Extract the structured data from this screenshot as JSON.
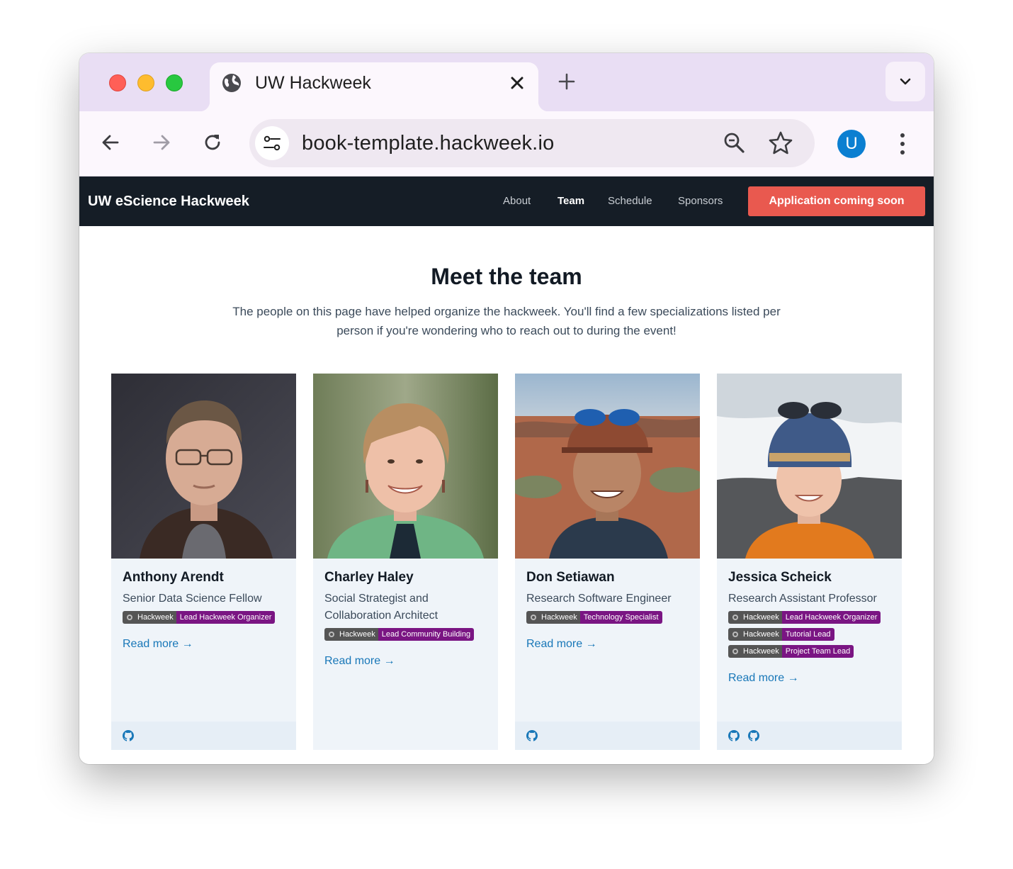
{
  "browser": {
    "tab_title": "UW Hackweek",
    "url": "book-template.hackweek.io",
    "profile_initial": "U"
  },
  "navbar": {
    "brand": "UW eScience Hackweek",
    "links": [
      {
        "label": "About"
      },
      {
        "label": "Team",
        "active": true
      },
      {
        "label": "Schedule"
      },
      {
        "label": "Sponsors"
      }
    ],
    "cta_label": "Application coming soon"
  },
  "page": {
    "title": "Meet the team",
    "intro": "The people on this page have helped organize the hackweek. You'll find a few specializations listed per person if you're wondering who to reach out to during the event!"
  },
  "team": [
    {
      "name": "Anthony Arendt",
      "role": "Senior Data Science Fellow",
      "badges": [
        {
          "left": "Hackweek",
          "right": "Lead Hackweek Organizer"
        }
      ],
      "read_more": "Read more →",
      "footer_icons": [
        "github-icon"
      ]
    },
    {
      "name": "Charley Haley",
      "role": "Social Strategist and Collaboration Architect",
      "badges": [
        {
          "left": "Hackweek",
          "right": "Lead Community Building"
        }
      ],
      "read_more": "Read more →",
      "footer_icons": []
    },
    {
      "name": "Don Setiawan",
      "role": "Research Software Engineer",
      "badges": [
        {
          "left": "Hackweek",
          "right": "Technology Specialist"
        }
      ],
      "read_more": "Read more →",
      "footer_icons": [
        "github-icon"
      ]
    },
    {
      "name": "Jessica Scheick",
      "role": "Research Assistant Professor",
      "badges": [
        {
          "left": "Hackweek",
          "right": "Lead Hackweek Organizer"
        },
        {
          "left": "Hackweek",
          "right": "Tutorial Lead"
        },
        {
          "left": "Hackweek",
          "right": "Project Team Lead"
        }
      ],
      "read_more": "Read more →",
      "footer_icons": [
        "github-icon",
        "github-icon"
      ]
    }
  ],
  "colors": {
    "navbar_bg": "#151d26",
    "cta_bg": "#e9594f",
    "badge_label_bg": "#555555",
    "badge_value_bg": "#7a1583",
    "link": "#1877b8",
    "card_bg": "#eff4f9"
  }
}
